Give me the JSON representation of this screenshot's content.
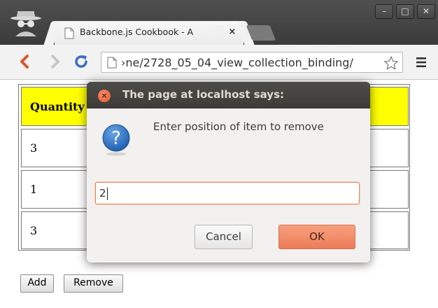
{
  "browser": {
    "tab_title": "Backbone.js Cookbook - A",
    "tab_close_glyph": "×",
    "address": "›ne/2728_05_04_view_collection_binding/",
    "window_buttons": [
      "–",
      "□",
      "✕"
    ],
    "icons": [
      "incognito-icon",
      "page-icon",
      "back-arrow-icon",
      "forward-arrow-icon",
      "reload-icon",
      "star-icon",
      "menu-icon",
      "new-tab-button"
    ]
  },
  "page": {
    "table": {
      "header": "Quantity",
      "rows": [
        "3",
        "1",
        "3"
      ],
      "header_color": "#ffff00"
    },
    "buttons": {
      "add": "Add",
      "remove": "Remove"
    }
  },
  "dialog": {
    "title": "The page at localhost says:",
    "close_glyph": "×",
    "message": "Enter position of item to remove",
    "input_value": "2",
    "cancel_label": "Cancel",
    "ok_label": "OK",
    "icon": "question-icon",
    "accent_color": "#ec7c58"
  }
}
